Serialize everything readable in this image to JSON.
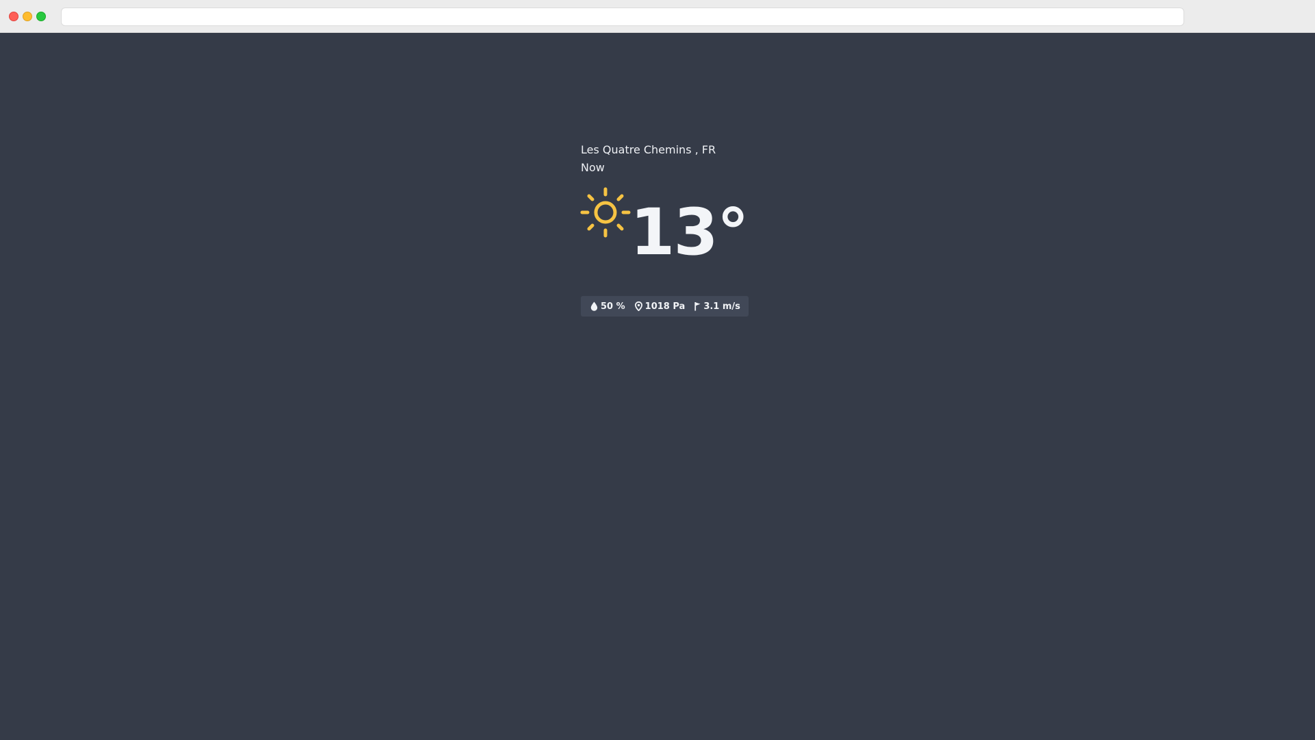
{
  "browser": {
    "address": ""
  },
  "weather": {
    "location": "Les Quatre Chemins , FR",
    "time_label": "Now",
    "temperature": "13°",
    "condition_icon": "sun-icon",
    "humidity": "50 %",
    "pressure": "1018 Pa",
    "wind": "3.1 m/s"
  },
  "colors": {
    "background": "#353b48",
    "sun": "#f6c343",
    "stats_bg": "#414857",
    "text": "#eef0f4"
  }
}
